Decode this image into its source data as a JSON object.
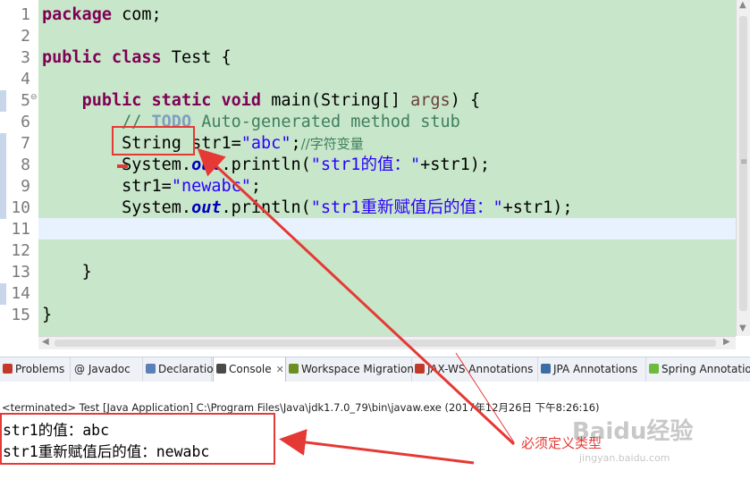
{
  "editor": {
    "line_numbers": [
      "1",
      "2",
      "3",
      "4",
      "5",
      "6",
      "7",
      "8",
      "9",
      "10",
      "11",
      "12",
      "13",
      "14",
      "15"
    ],
    "line1": {
      "kw": "package",
      "rest": " com;"
    },
    "line3": {
      "kw1": "public",
      "kw2": "class",
      "rest": " Test {"
    },
    "line5": {
      "kw1": "public",
      "kw2": "static",
      "kw3": "void",
      "mid": " main(String[] ",
      "param": "args",
      "end": ") {"
    },
    "line6": {
      "c1": "// ",
      "todo": "TODO",
      "c2": " Auto-generated method stub"
    },
    "line7": {
      "type": "String",
      "decl": " str1=",
      "str": "\"abc\"",
      "semi": ";",
      "cmt": "//字符变量"
    },
    "line8": {
      "a": "System.",
      "fld": "out",
      "b": ".println(",
      "str": "\"str1的值：\"",
      "c": "+str1);"
    },
    "line9": {
      "a": "str1=",
      "str": "\"newabc\"",
      "b": ";"
    },
    "line10": {
      "a": "System.",
      "fld": "out",
      "b": ".println(",
      "str": "\"str1重新赋值后的值：\"",
      "c": "+str1);"
    },
    "line13": "}",
    "line15": "}"
  },
  "tabs": [
    {
      "label": "Problems",
      "icon_color": "#c0392b"
    },
    {
      "label": "@ Javadoc",
      "icon_color": ""
    },
    {
      "label": "Declaration",
      "icon_color": "#5b7fb8"
    },
    {
      "label": "Console",
      "icon_color": "#4a4a4a",
      "close": "✕"
    },
    {
      "label": "Workspace Migration",
      "icon_color": "#6b8e23"
    },
    {
      "label": "JAX-WS Annotations",
      "icon_color": "#c0392b"
    },
    {
      "label": "JPA Annotations",
      "icon_color": "#3a6ea5"
    },
    {
      "label": "Spring Annotation",
      "icon_color": "#6cbb3c"
    }
  ],
  "console": {
    "status": "<terminated> Test [Java Application] C:\\Program Files\\Java\\jdk1.7.0_79\\bin\\javaw.exe (2017年12月26日 下午8:26:16)",
    "output": [
      "str1的值：abc",
      "str1重新赋值后的值：newabc"
    ]
  },
  "annotation": {
    "label": "必须定义类型",
    "color": "#e53935"
  },
  "watermark": {
    "main": "Baidu经验",
    "sub": "jingyan.baidu.com"
  }
}
